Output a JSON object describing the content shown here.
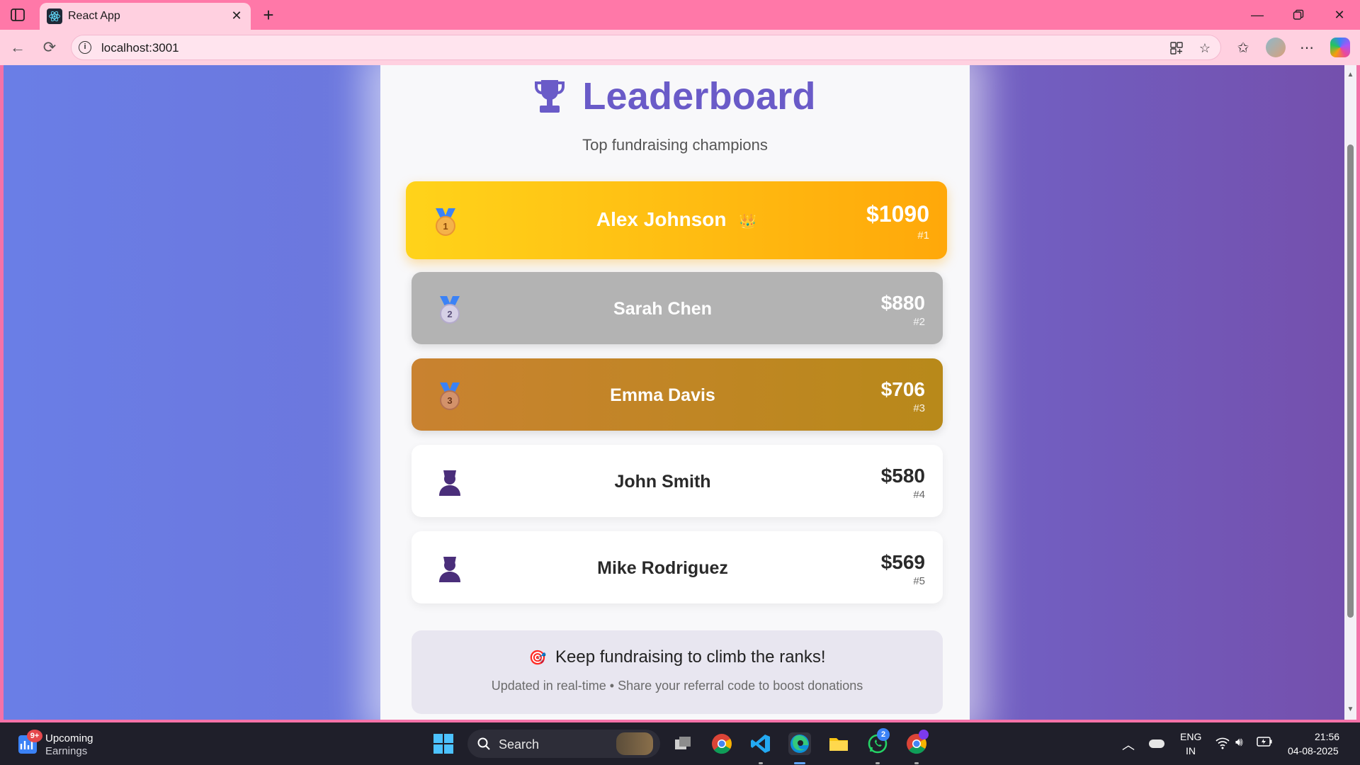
{
  "browser": {
    "tab_title": "React App",
    "url": "localhost:3001"
  },
  "page": {
    "title": "Leaderboard",
    "subtitle": "Top fundraising champions",
    "entries": [
      {
        "rank_label": "#1",
        "name": "Alex Johnson",
        "amount": "$1090",
        "crown": "👑",
        "medal_number": "1"
      },
      {
        "rank_label": "#2",
        "name": "Sarah Chen",
        "amount": "$880",
        "medal_number": "2"
      },
      {
        "rank_label": "#3",
        "name": "Emma Davis",
        "amount": "$706",
        "medal_number": "3"
      },
      {
        "rank_label": "#4",
        "name": "John Smith",
        "amount": "$580"
      },
      {
        "rank_label": "#5",
        "name": "Mike Rodriguez",
        "amount": "$569"
      }
    ],
    "footer": {
      "emoji": "🎯",
      "title": "Keep fundraising to climb the ranks!",
      "subtitle": "Updated in real-time • Share your referral code to boost donations"
    },
    "colors": {
      "title": "#6a5bc8",
      "gold": "#ffc107",
      "silver": "#b0b0b0",
      "bronze": "#c6842c"
    }
  },
  "taskbar": {
    "widget_title": "Upcoming",
    "widget_subtitle": "Earnings",
    "widget_badge": "9+",
    "search_label": "Search",
    "whatsapp_badge": "2",
    "language_top": "ENG",
    "language_bottom": "IN",
    "time": "21:56",
    "date": "04-08-2025"
  }
}
